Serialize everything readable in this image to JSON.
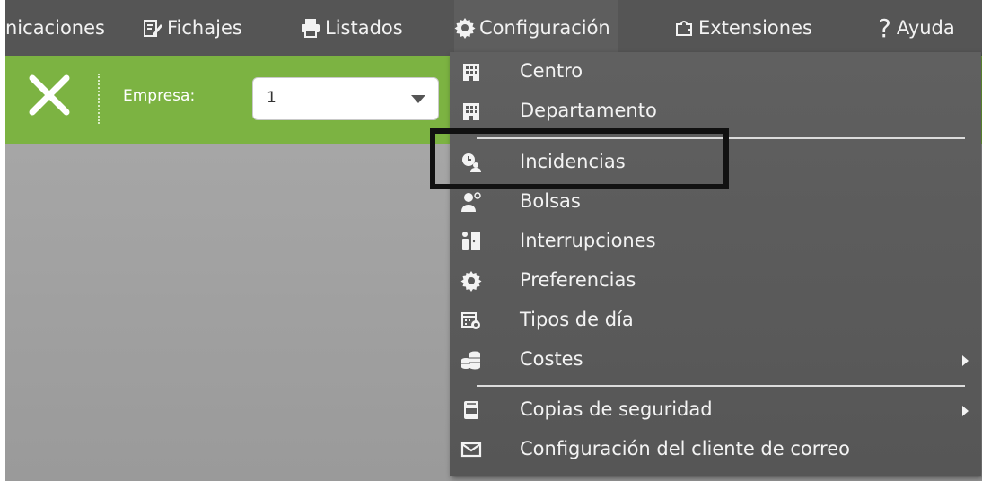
{
  "menubar": {
    "items": [
      {
        "label": "nicaciones",
        "icon": "none"
      },
      {
        "label": "Fichajes",
        "icon": "edit-icon"
      },
      {
        "label": "Listados",
        "icon": "printer-icon"
      },
      {
        "label": "Configuración",
        "icon": "gear-icon"
      },
      {
        "label": "Extensiones",
        "icon": "puzzle-icon"
      },
      {
        "label": "Ayuda",
        "icon": "question-icon"
      }
    ]
  },
  "toolbar": {
    "empresa_label": "Empresa:",
    "empresa_value": "1"
  },
  "dropdown": {
    "items": [
      {
        "label": "Centro",
        "icon": "building-icon",
        "submenu": false
      },
      {
        "label": "Departamento",
        "icon": "building-icon",
        "submenu": false
      },
      {
        "label": "Incidencias",
        "icon": "clock-user-icon",
        "submenu": false
      },
      {
        "label": "Bolsas",
        "icon": "user-bag-icon",
        "submenu": false
      },
      {
        "label": "Interrupciones",
        "icon": "person-door-icon",
        "submenu": false
      },
      {
        "label": "Preferencias",
        "icon": "gear-icon",
        "submenu": false
      },
      {
        "label": "Tipos de día",
        "icon": "calendar-icon",
        "submenu": false
      },
      {
        "label": "Costes",
        "icon": "coins-icon",
        "submenu": true
      },
      {
        "label": "Copias de seguridad",
        "icon": "backup-icon",
        "submenu": true
      },
      {
        "label": "Configuración del cliente de correo",
        "icon": "mail-icon",
        "submenu": false
      }
    ]
  },
  "colors": {
    "menubar_bg": "#555555",
    "toolbar_green": "#7cb342",
    "dropdown_bg": "#5a5a5a",
    "highlight_border": "#111111"
  }
}
